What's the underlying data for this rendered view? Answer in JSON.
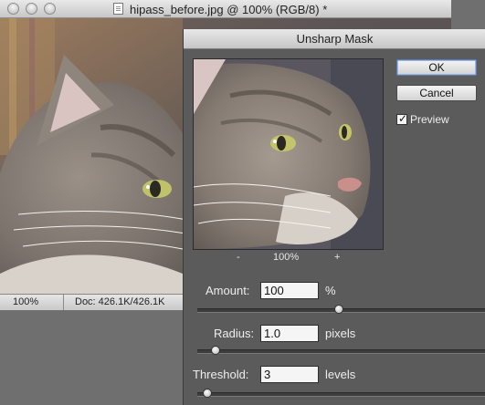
{
  "document": {
    "title": "hipass_before.jpg @ 100% (RGB/8) *",
    "status_zoom": "100%",
    "status_info": "Doc: 426.1K/426.1K"
  },
  "dialog": {
    "title": "Unsharp Mask",
    "preview_zoom": "100%",
    "zoom_out": "-",
    "zoom_in": "+",
    "ok_label": "OK",
    "cancel_label": "Cancel",
    "preview_label": "Preview",
    "preview_checked": true,
    "params": {
      "amount": {
        "label": "Amount:",
        "value": "100",
        "unit": "%",
        "slider_fraction": 0.5
      },
      "radius": {
        "label": "Radius:",
        "value": "1.0",
        "unit": "pixels",
        "slider_fraction": 0.05
      },
      "threshold": {
        "label": "Threshold:",
        "value": "3",
        "unit": "levels",
        "slider_fraction": 0.02
      }
    }
  },
  "icons": {
    "file": "jpeg-file-icon",
    "checkbox": "checkmark-icon"
  }
}
